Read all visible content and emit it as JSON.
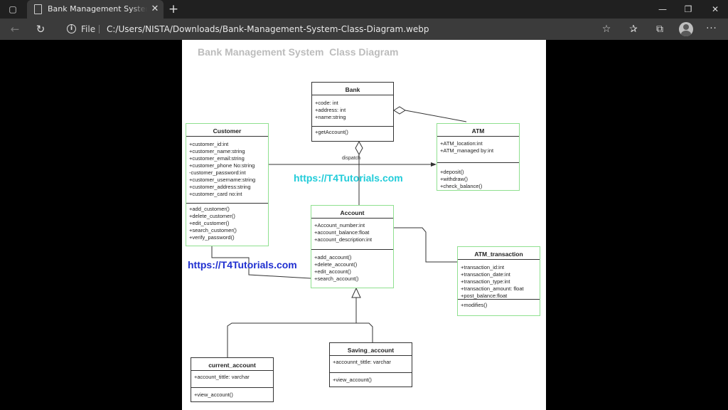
{
  "browser": {
    "tab_title": "Bank Management System Class Diagram",
    "tab_close": "✕",
    "new_tab": "+",
    "window_min": "—",
    "window_restore": "❐",
    "window_close": "✕",
    "back": "←",
    "refresh": "↻",
    "info": "i",
    "file_label": "File",
    "url": "C:/Users/NISTA/Downloads/Bank-Management-System-Class-Diagram.webp",
    "fav_add": "☆",
    "favorites": "✰",
    "collections": "⧉",
    "menu": "···",
    "tab_actions": "▢"
  },
  "diagram": {
    "title": "Bank Management System  Class Diagram",
    "watermark_1": "https://T4Tutorials.com",
    "watermark_2": "https://T4Tutorials.com",
    "dispatch_label": "dispatch",
    "classes": {
      "bank": {
        "name": "Bank",
        "attributes": [
          "+code: int",
          "+address: int",
          "+name:string"
        ],
        "operations": [
          "+getAccount()"
        ]
      },
      "customer": {
        "name": "Customer",
        "attributes": [
          "+customer_id:int",
          "+customer_name:string",
          "+customer_email:string",
          "+customer_phone No:string",
          "-customer_password:int",
          "+customer_username:string",
          "+customer_address:string",
          "+customer_card no:int"
        ],
        "operations": [
          "+add_customer()",
          "+delete_customer()",
          "+edit_customer()",
          "+search_customer()",
          "+verify_password()"
        ]
      },
      "atm": {
        "name": "ATM",
        "attributes": [
          "+ATM_location:int",
          "+ATM_managed by:int"
        ],
        "operations": [
          "+deposit()",
          "+withdraw()",
          "+check_balance()"
        ]
      },
      "account": {
        "name": "Account",
        "attributes": [
          "+Account_number:int",
          "+account_balance:float",
          "+account_description:int"
        ],
        "operations": [
          "+add_account()",
          "+delete_account()",
          "+edit_account()",
          "+search_account()"
        ]
      },
      "atm_transaction": {
        "name": "ATM_transaction",
        "attributes": [
          "+transaction_id:int",
          "+transaction_date:int",
          "+transaction_type:int",
          "+transaction_amount: float",
          "+post_balance:float"
        ],
        "operations": [
          "+modifies()"
        ]
      },
      "saving_account": {
        "name": "Saving_account",
        "attributes": [
          "+accounnt_tittle: varchar"
        ],
        "operations": [
          "+view_account()"
        ]
      },
      "current_account": {
        "name": "current_account",
        "attributes": [
          "+account_tittle: varchar"
        ],
        "operations": [
          "+view_account()"
        ]
      }
    }
  }
}
